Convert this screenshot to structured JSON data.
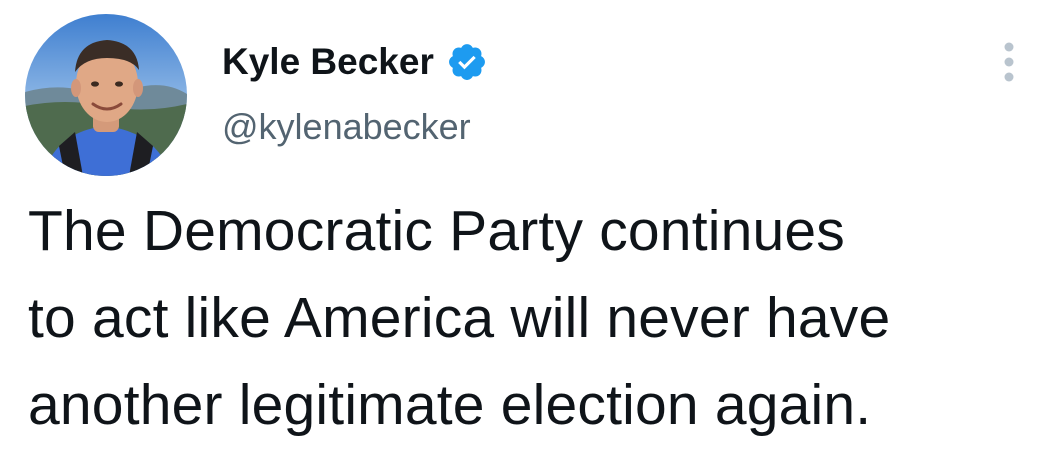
{
  "author": {
    "display_name": "Kyle Becker",
    "handle": "@kylenabecker",
    "verified": true,
    "avatar_icon": "profile-photo",
    "verified_icon": "verified-badge-icon"
  },
  "tweet": {
    "lines": [
      "The Democratic Party continues",
      "to act like America will never have",
      "another legitimate election again."
    ]
  },
  "menu": {
    "icon": "more-vertical-icon"
  },
  "colors": {
    "text": "#0f1419",
    "secondary_text": "#536471",
    "verified_blue": "#1d9bf0",
    "menu_dots": "#b9c4ce"
  }
}
